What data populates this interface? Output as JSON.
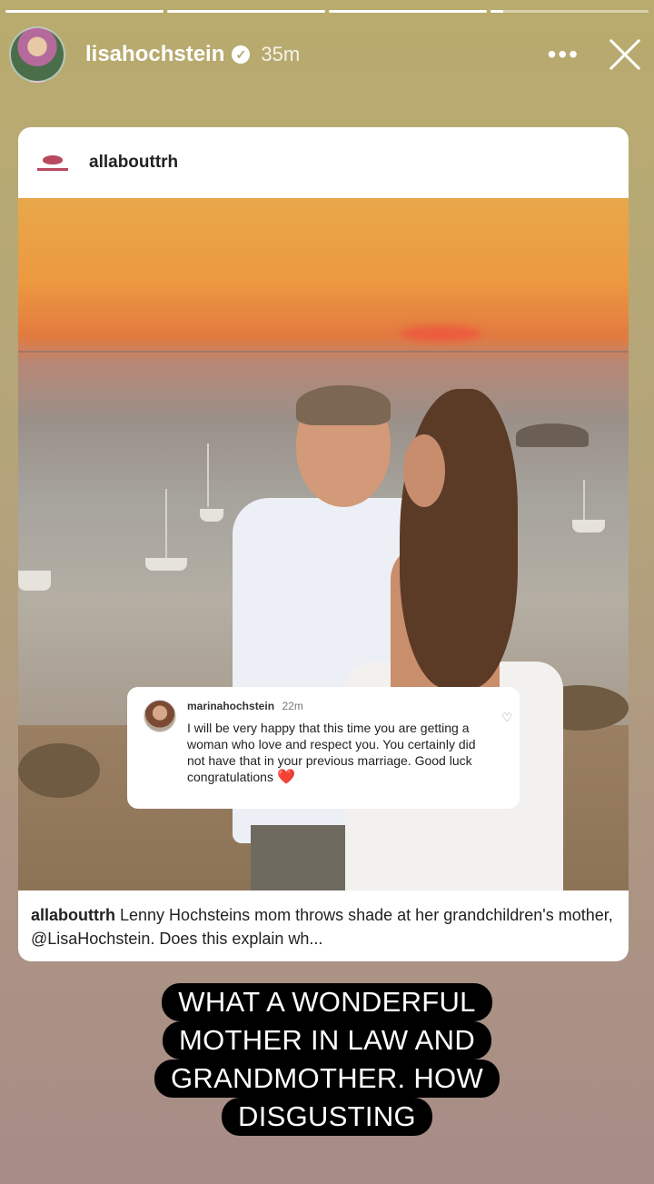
{
  "story": {
    "progress_segments": [
      1,
      1,
      1,
      0.08
    ]
  },
  "header": {
    "username": "lisahochstein",
    "verified_icon": "verified-badge-icon",
    "time": "35m",
    "more_icon": "more-horizontal-icon",
    "more_label": "•••",
    "close_icon": "close-icon"
  },
  "post": {
    "account": "allabouttrh",
    "comment": {
      "username": "marinahochstein",
      "time": "22m",
      "text": "I will be very happy that this time you are getting a woman who love and respect you. You certainly did not have that in your previous marriage. Good luck congratulations",
      "heart_emoji": "❤️",
      "like_icon": "heart-outline-icon",
      "like_glyph": "♡"
    },
    "caption": {
      "username": "allabouttrh",
      "text": "Lenny Hochsteins mom throws shade at her grandchildren's mother, @LisaHochstein. Does this explain wh..."
    }
  },
  "story_text": {
    "lines": [
      "WHAT A WONDERFUL",
      "MOTHER IN LAW AND",
      "GRANDMOTHER. HOW",
      "DISGUSTING"
    ]
  }
}
